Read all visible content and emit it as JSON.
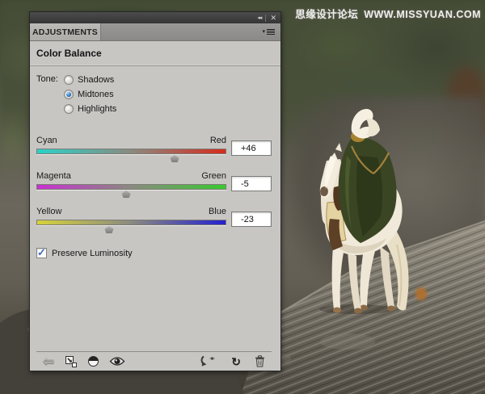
{
  "watermark": {
    "site_name_cn": "思缘设计论坛",
    "site_url": "WWW.MISSYUAN.COM"
  },
  "panel": {
    "window_controls": {
      "collapse_glyph": "◂◂",
      "close_glyph": "✕"
    },
    "tab_label": "ADJUSTMENTS",
    "menu_glyph": "▾",
    "title": "Color Balance",
    "tone": {
      "label": "Tone:",
      "options": [
        {
          "label": "Shadows",
          "selected": false
        },
        {
          "label": "Midtones",
          "selected": true
        },
        {
          "label": "Highlights",
          "selected": false
        }
      ]
    },
    "sliders": [
      {
        "left_label": "Cyan",
        "right_label": "Red",
        "value": 46,
        "display": "+46",
        "min": -100,
        "max": 100,
        "gradient": [
          "#2ad2c9",
          "#8a8a80",
          "#d62b1e"
        ]
      },
      {
        "left_label": "Magenta",
        "right_label": "Green",
        "value": -5,
        "display": "-5",
        "min": -100,
        "max": 100,
        "gradient": [
          "#c92fd2",
          "#8a8a80",
          "#38c92e"
        ]
      },
      {
        "left_label": "Yellow",
        "right_label": "Blue",
        "value": -23,
        "display": "-23",
        "min": -100,
        "max": 100,
        "gradient": [
          "#d6d23c",
          "#8a8a80",
          "#2521cf"
        ]
      }
    ],
    "preserve_luminosity": {
      "label": "Preserve Luminosity",
      "checked": true
    },
    "toolbar": {
      "back_glyph": "⇦",
      "reset_glyph": "↻",
      "icon_names": [
        "return-to-adjustment-list",
        "clip-to-layer",
        "adjustment-scope",
        "toggle-visibility",
        "view-previous-state",
        "reset-to-defaults",
        "delete-adjustment"
      ]
    }
  }
}
